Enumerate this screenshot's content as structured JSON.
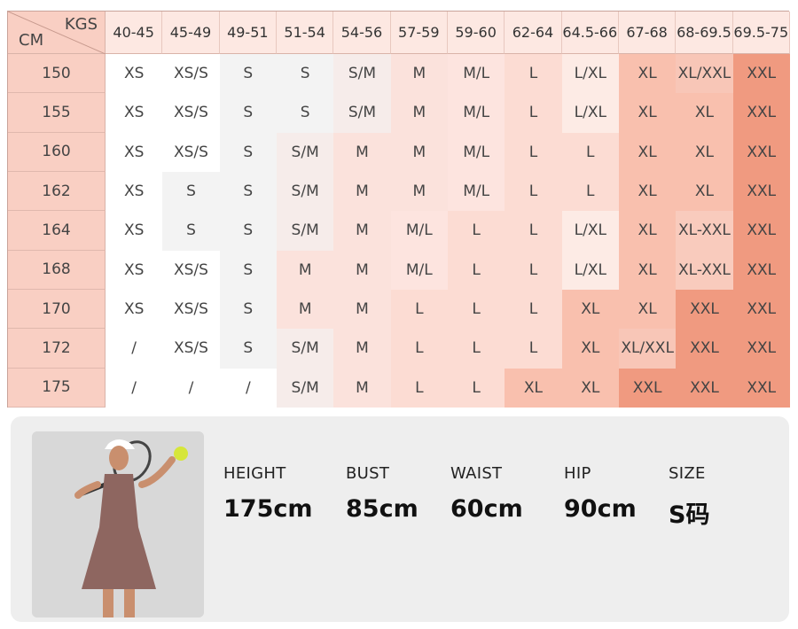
{
  "header": {
    "weight_unit": "KGS",
    "height_unit": "CM"
  },
  "weights": [
    "40-45",
    "45-49",
    "49-51",
    "51-54",
    "54-56",
    "57-59",
    "59-60",
    "62-64",
    "64.5-66",
    "67-68",
    "68-69.5",
    "69.5-75"
  ],
  "rows": [
    {
      "height": "150",
      "sizes": [
        "XS",
        "XS/S",
        "S",
        "S",
        "S/M",
        "M",
        "M/L",
        "L",
        "L/XL",
        "XL",
        "XL/XXL",
        "XXL"
      ]
    },
    {
      "height": "155",
      "sizes": [
        "XS",
        "XS/S",
        "S",
        "S",
        "S/M",
        "M",
        "M/L",
        "L",
        "L/XL",
        "XL",
        "XL",
        "XXL"
      ]
    },
    {
      "height": "160",
      "sizes": [
        "XS",
        "XS/S",
        "S",
        "S/M",
        "M",
        "M",
        "M/L",
        "L",
        "L",
        "XL",
        "XL",
        "XXL"
      ]
    },
    {
      "height": "162",
      "sizes": [
        "XS",
        "S",
        "S",
        "S/M",
        "M",
        "M",
        "M/L",
        "L",
        "L",
        "XL",
        "XL",
        "XXL"
      ]
    },
    {
      "height": "164",
      "sizes": [
        "XS",
        "S",
        "S",
        "S/M",
        "M",
        "M/L",
        "L",
        "L",
        "L/XL",
        "XL",
        "XL-XXL",
        "XXL"
      ]
    },
    {
      "height": "168",
      "sizes": [
        "XS",
        "XS/S",
        "S",
        "M",
        "M",
        "M/L",
        "L",
        "L",
        "L/XL",
        "XL",
        "XL-XXL",
        "XXL"
      ]
    },
    {
      "height": "170",
      "sizes": [
        "XS",
        "XS/S",
        "S",
        "M",
        "M",
        "L",
        "L",
        "L",
        "XL",
        "XL",
        "XXL",
        "XXL"
      ]
    },
    {
      "height": "172",
      "sizes": [
        "/",
        "XS/S",
        "S",
        "S/M",
        "M",
        "L",
        "L",
        "L",
        "XL",
        "XL/XXL",
        "XXL",
        "XXL"
      ]
    },
    {
      "height": "175",
      "sizes": [
        "/",
        "/",
        "/",
        "S/M",
        "M",
        "L",
        "L",
        "XL",
        "XL",
        "XXL",
        "XXL",
        "XXL"
      ]
    }
  ],
  "size_colors": {
    "/": "#ffffff",
    "XS": "#ffffff",
    "XS/S": "#ffffff",
    "S": "#f3f3f3",
    "S/M": "#f6ecea",
    "M": "#fbe2dc",
    "M/L": "#fde4df",
    "L": "#fcdcd3",
    "L/XL": "#fdebe5",
    "XL": "#f9c0ae",
    "XL/XXL": "#f8c6b7",
    "XL-XXL": "#f9cbbd",
    "XXL": "#f09a80"
  },
  "model": {
    "stats": [
      {
        "label": "HEIGHT",
        "value": "175cm"
      },
      {
        "label": "BUST",
        "value": "85cm"
      },
      {
        "label": "WAIST",
        "value": "60cm"
      },
      {
        "label": "HIP",
        "value": "90cm"
      },
      {
        "label": "SIZE",
        "value": "S码"
      }
    ]
  }
}
